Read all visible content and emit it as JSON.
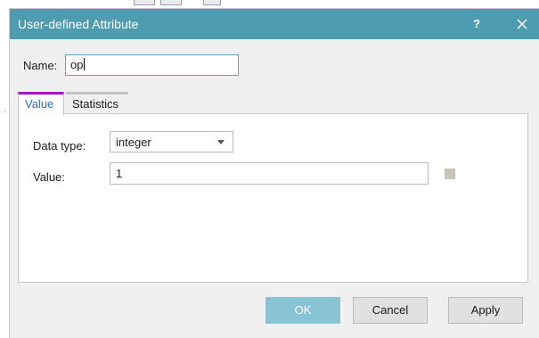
{
  "dialog": {
    "title": "User-defined Attribute",
    "help_label": "?",
    "title_bar_color": "#4e9cb0"
  },
  "name_field": {
    "label": "Name:",
    "value": "op"
  },
  "tabs": [
    {
      "label": "Value",
      "active": true
    },
    {
      "label": "Statistics",
      "active": false
    }
  ],
  "value_panel": {
    "data_type_label": "Data type:",
    "data_type_selected": "integer",
    "value_label": "Value:",
    "value": "1",
    "swatch_color": "#c8c4b8"
  },
  "buttons": {
    "ok": "OK",
    "ok_color": "#89c4d4",
    "cancel": "Cancel",
    "apply": "Apply"
  },
  "icons": {
    "close": "close-icon",
    "dropdown": "chevron-down-icon"
  },
  "colors": {
    "active_tab_accent": "#a016c8",
    "focus_border": "#5aa8bd"
  }
}
